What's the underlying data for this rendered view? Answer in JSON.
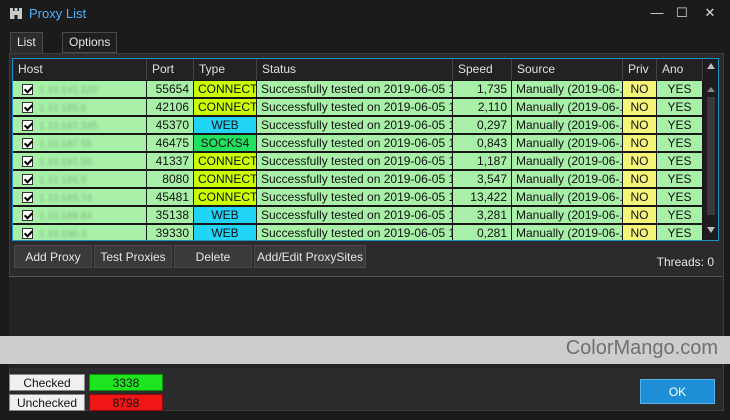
{
  "window": {
    "title": "Proxy List",
    "icon": "castle-icon"
  },
  "tabs": [
    "List",
    "Options"
  ],
  "columns": [
    "Host",
    "Port",
    "Type",
    "Status",
    "Speed",
    "Source",
    "Priv",
    "Ano"
  ],
  "rows": [
    {
      "host": "1.10.141.220",
      "port": "55654",
      "type": "CONNECT",
      "status": "Successfully tested on 2019-06-05 12...",
      "speed": "1,735",
      "source": "Manually (2019-06-...",
      "priv": "NO",
      "ano": "YES"
    },
    {
      "host": "1.10.185.6",
      "port": "42106",
      "type": "CONNECT",
      "status": "Successfully tested on 2019-06-05 12...",
      "speed": "2,110",
      "source": "Manually (2019-06-...",
      "priv": "NO",
      "ano": "YES"
    },
    {
      "host": "1.10.187.245",
      "port": "45370",
      "type": "WEB",
      "status": "Successfully tested on 2019-06-05 11...",
      "speed": "0,297",
      "source": "Manually (2019-06-...",
      "priv": "NO",
      "ano": "YES"
    },
    {
      "host": "1.10.187.55",
      "port": "46475",
      "type": "SOCKS4",
      "status": "Successfully tested on 2019-06-05 11...",
      "speed": "0,843",
      "source": "Manually (2019-06-...",
      "priv": "NO",
      "ano": "YES"
    },
    {
      "host": "1.10.187.55",
      "port": "41337",
      "type": "CONNECT",
      "status": "Successfully tested on 2019-06-05 11...",
      "speed": "1,187",
      "source": "Manually (2019-06-...",
      "priv": "NO",
      "ano": "YES"
    },
    {
      "host": "1.10.188.5",
      "port": "8080",
      "type": "CONNECT",
      "status": "Successfully tested on 2019-06-05 11...",
      "speed": "3,547",
      "source": "Manually (2019-06-...",
      "priv": "NO",
      "ano": "YES"
    },
    {
      "host": "1.10.189.74",
      "port": "45481",
      "type": "CONNECT",
      "status": "Successfully tested on 2019-06-05 11...",
      "speed": "13,422",
      "source": "Manually (2019-06-...",
      "priv": "NO",
      "ano": "YES"
    },
    {
      "host": "1.10.189.84",
      "port": "35138",
      "type": "WEB",
      "status": "Successfully tested on 2019-06-05 11...",
      "speed": "3,281",
      "source": "Manually (2019-06-...",
      "priv": "NO",
      "ano": "YES"
    },
    {
      "host": "1.10.190.3",
      "port": "39330",
      "type": "WEB",
      "status": "Successfully tested on 2019-06-05 11...",
      "speed": "0,281",
      "source": "Manually (2019-06-...",
      "priv": "NO",
      "ano": "YES"
    }
  ],
  "type_colors": {
    "CONNECT": "#ccff00",
    "WEB": "#22d4f7",
    "SOCKS4": "#22e060"
  },
  "buttons": {
    "add": "Add Proxy",
    "test": "Test Proxies",
    "delete": "Delete",
    "sites": "Add/Edit ProxySites"
  },
  "threads": "Threads: 0",
  "watermark": "ColorMango.com",
  "stats": {
    "checked_label": "Checked",
    "checked_value": "3338",
    "unchecked_label": "Unchecked",
    "unchecked_value": "8798"
  },
  "ok": "OK"
}
